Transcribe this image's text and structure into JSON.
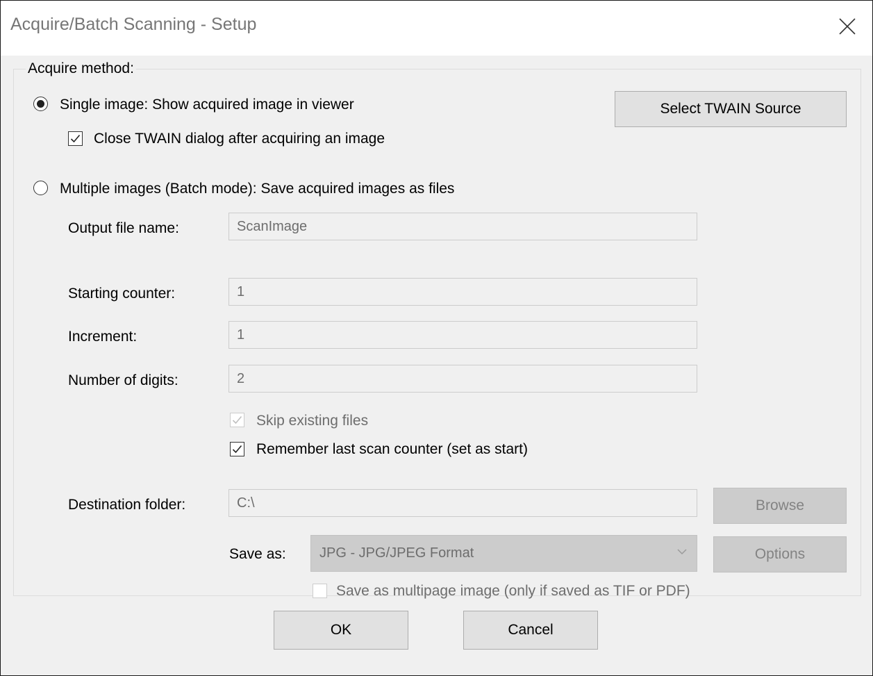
{
  "window": {
    "title": "Acquire/Batch Scanning - Setup"
  },
  "group": {
    "legend": "Acquire method:"
  },
  "single": {
    "label": "Single image: Show acquired image in viewer",
    "close_twain_label": "Close TWAIN dialog after acquiring an image"
  },
  "select_twain_button": "Select TWAIN Source",
  "multiple": {
    "label": "Multiple images (Batch mode): Save acquired images as files"
  },
  "fields": {
    "output_file_name": {
      "label": "Output file name:",
      "value": "ScanImage"
    },
    "starting_counter": {
      "label": "Starting counter:",
      "value": "1"
    },
    "increment": {
      "label": "Increment:",
      "value": "1"
    },
    "number_of_digits": {
      "label": "Number of digits:",
      "value": "2"
    },
    "destination_folder": {
      "label": "Destination folder:",
      "value": "C:\\"
    }
  },
  "skip_existing_label": "Skip existing files",
  "remember_counter_label": "Remember last scan counter (set as start)",
  "browse_button": "Browse",
  "save_as": {
    "label": "Save as:",
    "value": "JPG - JPG/JPEG Format"
  },
  "options_button": "Options",
  "multipage_label": "Save as multipage image (only if saved as TIF or PDF)",
  "ok_button": "OK",
  "cancel_button": "Cancel",
  "icons": {
    "close": "close-icon",
    "check": "checkmark-icon",
    "dropdown": "chevron-down-icon"
  },
  "colors": {
    "dialog_bg": "#f0f0f0",
    "disabled_text": "#6d6d6d",
    "button_bg": "#e1e1e1",
    "disabled_button_bg": "#cccccc"
  }
}
